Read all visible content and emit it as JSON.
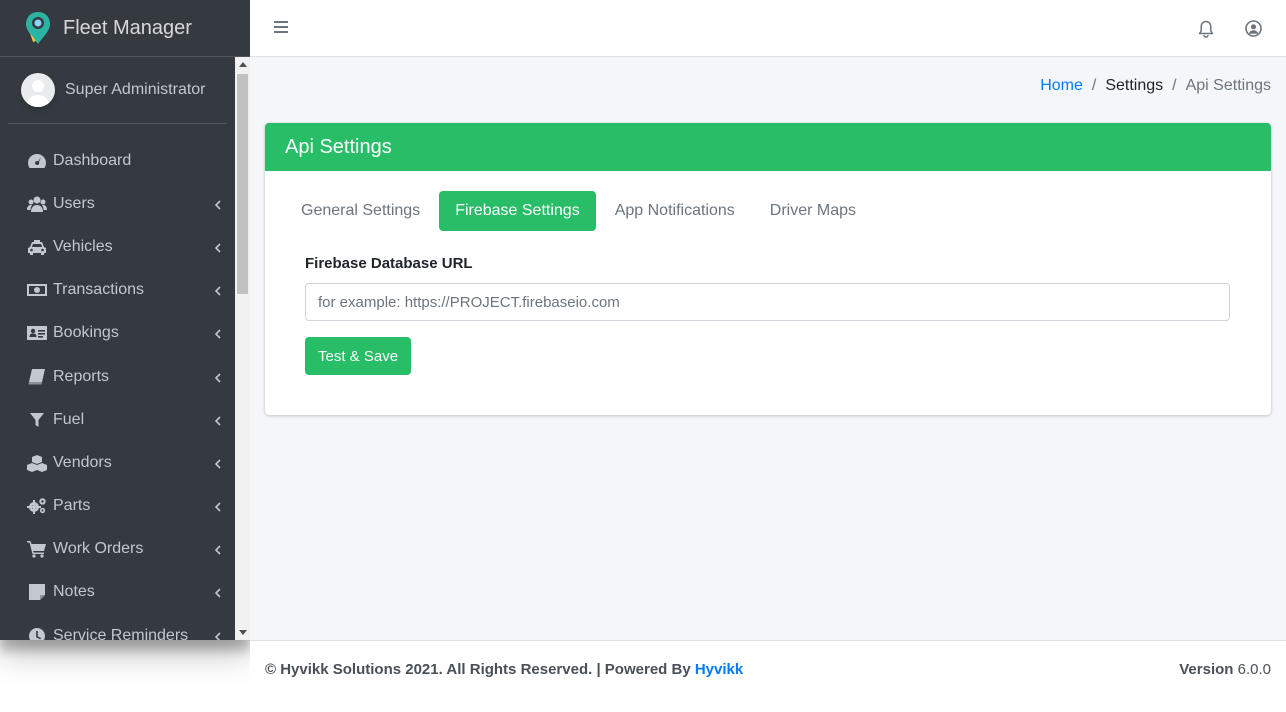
{
  "brand": {
    "name": "Fleet Manager"
  },
  "user": {
    "name": "Super Administrator"
  },
  "sidebar": {
    "items": [
      {
        "label": "Dashboard",
        "icon": "tachometer-icon",
        "has_children": false
      },
      {
        "label": "Users",
        "icon": "users-icon",
        "has_children": true
      },
      {
        "label": "Vehicles",
        "icon": "taxi-icon",
        "has_children": true
      },
      {
        "label": "Transactions",
        "icon": "money-icon",
        "has_children": true
      },
      {
        "label": "Bookings",
        "icon": "address-card-icon",
        "has_children": true
      },
      {
        "label": "Reports",
        "icon": "book-icon",
        "has_children": true
      },
      {
        "label": "Fuel",
        "icon": "filter-icon",
        "has_children": true
      },
      {
        "label": "Vendors",
        "icon": "cubes-icon",
        "has_children": true
      },
      {
        "label": "Parts",
        "icon": "gears-icon",
        "has_children": true
      },
      {
        "label": "Work Orders",
        "icon": "cart-icon",
        "has_children": true
      },
      {
        "label": "Notes",
        "icon": "sticky-note-icon",
        "has_children": true
      },
      {
        "label": "Service Reminders",
        "icon": "clock-icon",
        "has_children": true
      }
    ]
  },
  "breadcrumb": {
    "home": "Home",
    "settings": "Settings",
    "current": "Api Settings"
  },
  "card": {
    "title": "Api Settings",
    "tabs": [
      {
        "label": "General Settings",
        "active": false
      },
      {
        "label": "Firebase Settings",
        "active": true
      },
      {
        "label": "App Notifications",
        "active": false
      },
      {
        "label": "Driver Maps",
        "active": false
      }
    ],
    "field_label": "Firebase Database URL",
    "field_placeholder": "for example: https://PROJECT.firebaseio.com",
    "field_value": "",
    "save_label": "Test & Save"
  },
  "footer": {
    "copyright": "© Hyvikk Solutions 2021. All Rights Reserved. | Powered By ",
    "link": "Hyvikk",
    "version_label": "Version",
    "version": "6.0.0"
  },
  "colors": {
    "accent": "#28bd67",
    "sidebar": "#343a40",
    "link": "#007bff"
  }
}
